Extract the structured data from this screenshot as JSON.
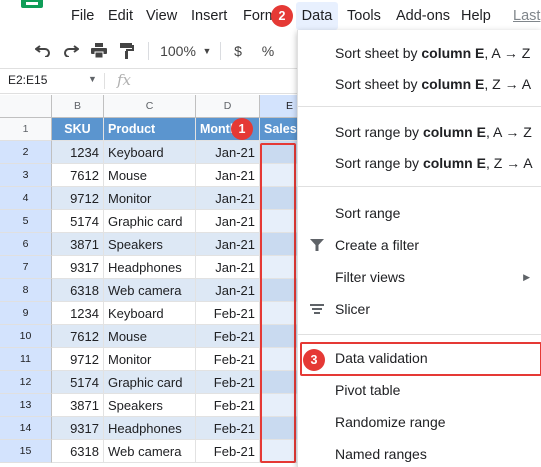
{
  "menubar": {
    "items": [
      "File",
      "Edit",
      "View",
      "Insert",
      "Form"
    ],
    "data_label": "Data",
    "tools_label": "Tools",
    "addons_label": "Add-ons",
    "help_label": "Help",
    "last_label": "Last"
  },
  "toolbar": {
    "zoom": "100%",
    "currency": "$",
    "percent": "%"
  },
  "formula_bar": {
    "namebox": "E2:E15",
    "fx": "fx"
  },
  "columns": [
    "B",
    "C",
    "D",
    "E"
  ],
  "rows": [
    "1",
    "2",
    "3",
    "4",
    "5",
    "6",
    "7",
    "8",
    "9",
    "10",
    "11",
    "12",
    "13",
    "14",
    "15"
  ],
  "table": {
    "headers": {
      "sku": "SKU",
      "product": "Product",
      "month": "Month",
      "sales": "Sales"
    },
    "rows": [
      {
        "sku": "1234",
        "product": "Keyboard",
        "month": "Jan-21"
      },
      {
        "sku": "7612",
        "product": "Mouse",
        "month": "Jan-21"
      },
      {
        "sku": "9712",
        "product": "Monitor",
        "month": "Jan-21"
      },
      {
        "sku": "5174",
        "product": "Graphic card",
        "month": "Jan-21"
      },
      {
        "sku": "3871",
        "product": "Speakers",
        "month": "Jan-21"
      },
      {
        "sku": "9317",
        "product": "Headphones",
        "month": "Jan-21"
      },
      {
        "sku": "6318",
        "product": "Web camera",
        "month": "Jan-21"
      },
      {
        "sku": "1234",
        "product": "Keyboard",
        "month": "Feb-21"
      },
      {
        "sku": "7612",
        "product": "Mouse",
        "month": "Feb-21"
      },
      {
        "sku": "9712",
        "product": "Monitor",
        "month": "Feb-21"
      },
      {
        "sku": "5174",
        "product": "Graphic card",
        "month": "Feb-21"
      },
      {
        "sku": "3871",
        "product": "Speakers",
        "month": "Feb-21"
      },
      {
        "sku": "9317",
        "product": "Headphones",
        "month": "Feb-21"
      },
      {
        "sku": "6318",
        "product": "Web camera",
        "month": "Feb-21"
      }
    ]
  },
  "dropdown": {
    "sort_sheet_az": {
      "prefix": "Sort sheet by ",
      "bold": "column E",
      "suffix": ", A → Z"
    },
    "sort_sheet_za": {
      "prefix": "Sort sheet by ",
      "bold": "column E",
      "suffix": ", Z → A"
    },
    "sort_range_az": {
      "prefix": "Sort range by ",
      "bold": "column E",
      "suffix": ", A → Z"
    },
    "sort_range_za": {
      "prefix": "Sort range by ",
      "bold": "column E",
      "suffix": ", Z → A"
    },
    "sort_range": "Sort range",
    "create_filter": "Create a filter",
    "filter_views": "Filter views",
    "slicer": "Slicer",
    "data_validation": "Data validation",
    "pivot_table": "Pivot table",
    "randomize_range": "Randomize range",
    "named_ranges": "Named ranges"
  },
  "badges": {
    "one": "1",
    "two": "2",
    "three": "3"
  },
  "colors": {
    "header_fill": "#5b95cf",
    "band_fill": "#dde8f5",
    "callout_red": "#e53935",
    "menu_active": "#e8f0fe"
  },
  "icons": [
    "sheets-logo-icon",
    "undo-icon",
    "redo-icon",
    "print-icon",
    "paint-format-icon",
    "chevron-down-icon",
    "filter-icon",
    "slicer-icon",
    "submenu-arrow-icon"
  ]
}
